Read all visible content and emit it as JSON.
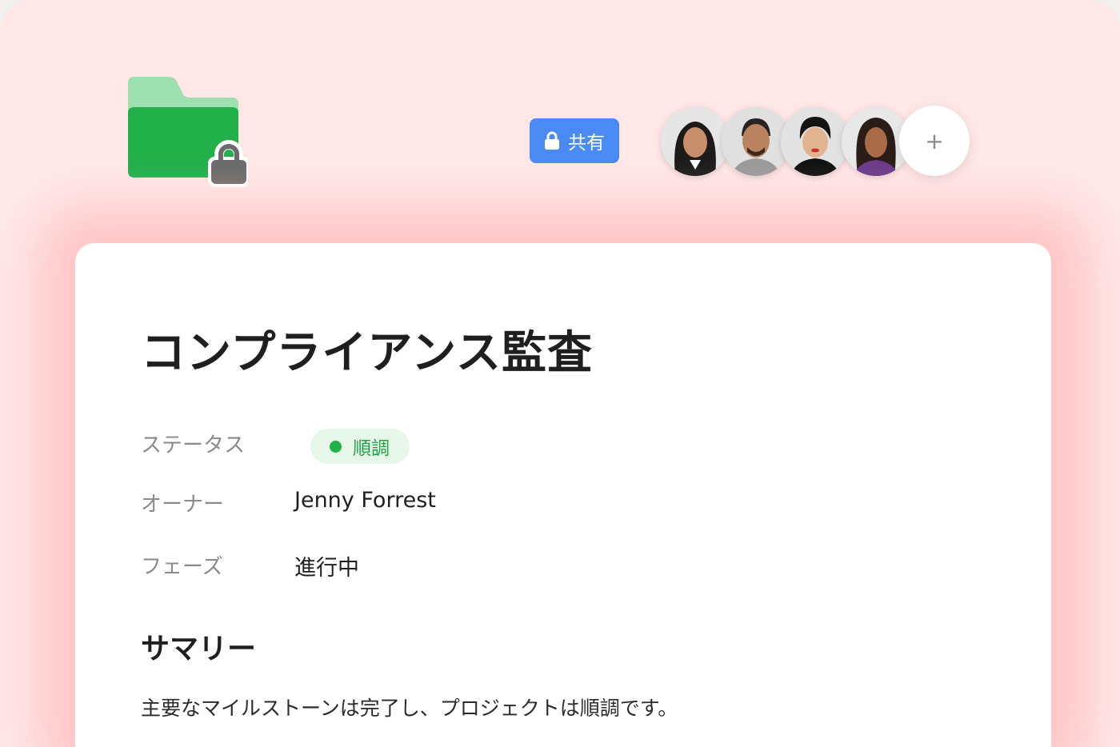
{
  "header": {
    "folder_icon": "locked-folder-icon",
    "share_badge": {
      "icon": "lock-icon",
      "label": "共有"
    },
    "members": {
      "avatars": [
        "avatar-1",
        "avatar-2",
        "avatar-3",
        "avatar-4"
      ],
      "add_label": "+"
    }
  },
  "colors": {
    "background": "#ffe6e7",
    "share_badge": "#4a8af4",
    "folder": "#22b04b",
    "status": "#22b04b"
  },
  "card": {
    "title": "コンプライアンス監査",
    "fields": {
      "status": {
        "label": "ステータス",
        "value": "順調"
      },
      "owner": {
        "label": "オーナー",
        "value": "Jenny Forrest"
      },
      "phase": {
        "label": "フェーズ",
        "value": "進行中"
      }
    },
    "summary": {
      "heading": "サマリー",
      "text": "主要なマイルストーンは完了し、プロジェクトは順調です。"
    }
  }
}
